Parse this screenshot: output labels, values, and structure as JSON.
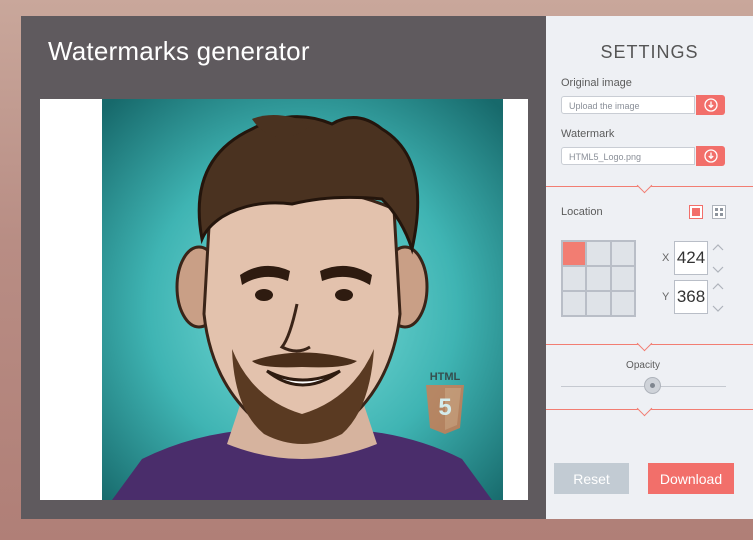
{
  "app": {
    "title": "Watermarks generator"
  },
  "preview": {
    "watermark_logo_text": "HTML",
    "watermark_logo_number": "5"
  },
  "settings": {
    "title": "SETTINGS",
    "original_image": {
      "label": "Original image",
      "placeholder": "Upload the image",
      "value": ""
    },
    "watermark": {
      "label": "Watermark",
      "value": "HTML5_Logo.png"
    },
    "location": {
      "label": "Location",
      "selected_mode": "single",
      "selected_cell": 0,
      "x_label": "X",
      "y_label": "Y",
      "x_value": "424",
      "y_value": "368"
    },
    "opacity": {
      "label": "Opacity",
      "value": 0.57
    },
    "buttons": {
      "reset": "Reset",
      "download": "Download"
    }
  },
  "colors": {
    "accent": "#f26f6a",
    "panel": "#5f5a5e",
    "sidebar": "#eef0f4",
    "reset": "#c2cbd3"
  }
}
